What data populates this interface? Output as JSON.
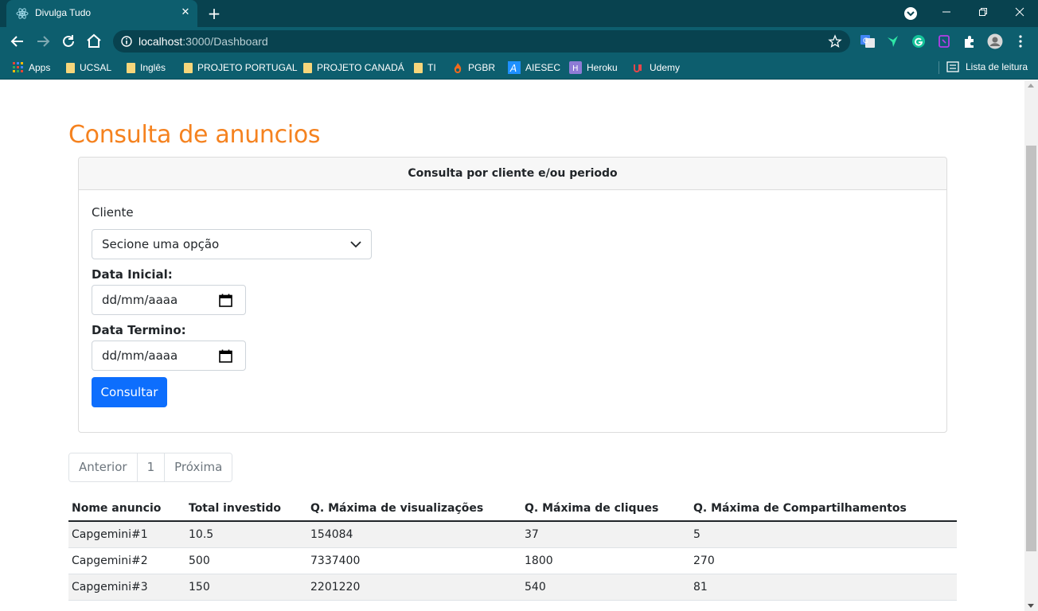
{
  "browser": {
    "tab_title": "Divulga Tudo",
    "url_host": "localhost",
    "url_path": ":3000/Dashboard",
    "bookmarks": [
      {
        "label": "Apps",
        "icon": "apps-grid-icon"
      },
      {
        "label": "UCSAL",
        "icon": "folder-icon"
      },
      {
        "label": "Inglês",
        "icon": "folder-icon"
      },
      {
        "label": "PROJETO PORTUGAL",
        "icon": "folder-icon"
      },
      {
        "label": "PROJETO CANADÁ",
        "icon": "folder-icon"
      },
      {
        "label": "TI",
        "icon": "folder-icon"
      },
      {
        "label": "PGBR",
        "icon": "flame-icon"
      },
      {
        "label": "AIESEC",
        "icon": "aiesec-icon"
      },
      {
        "label": "Heroku",
        "icon": "heroku-icon"
      },
      {
        "label": "Udemy",
        "icon": "udemy-icon"
      }
    ],
    "reading_list": "Lista de leitura"
  },
  "page": {
    "title": "Consulta de anuncios",
    "card_header": "Consulta por cliente e/ou periodo",
    "client_label": "Cliente",
    "client_select_value": "Secione uma opção",
    "start_label": "Data Inicial:",
    "start_value": "dd/mm/aaaa",
    "end_label": "Data Termino:",
    "end_value": "dd/mm/aaaa",
    "submit_label": "Consultar"
  },
  "pagination": {
    "prev": "Anterior",
    "current": "1",
    "next": "Próxima"
  },
  "table": {
    "headers": [
      "Nome anuncio",
      "Total investido",
      "Q. Máxima de visualizações",
      "Q. Máxima de cliques",
      "Q. Máxima de Compartilhamentos"
    ],
    "rows": [
      [
        "Capgemini#1",
        "10.5",
        "154084",
        "37",
        "5"
      ],
      [
        "Capgemini#2",
        "500",
        "7337400",
        "1800",
        "270"
      ],
      [
        "Capgemini#3",
        "150",
        "2201220",
        "540",
        "81"
      ]
    ]
  },
  "colors": {
    "title": "#f5821f",
    "primary": "#0d6efd",
    "browser_frame": "#0d5e6e"
  }
}
